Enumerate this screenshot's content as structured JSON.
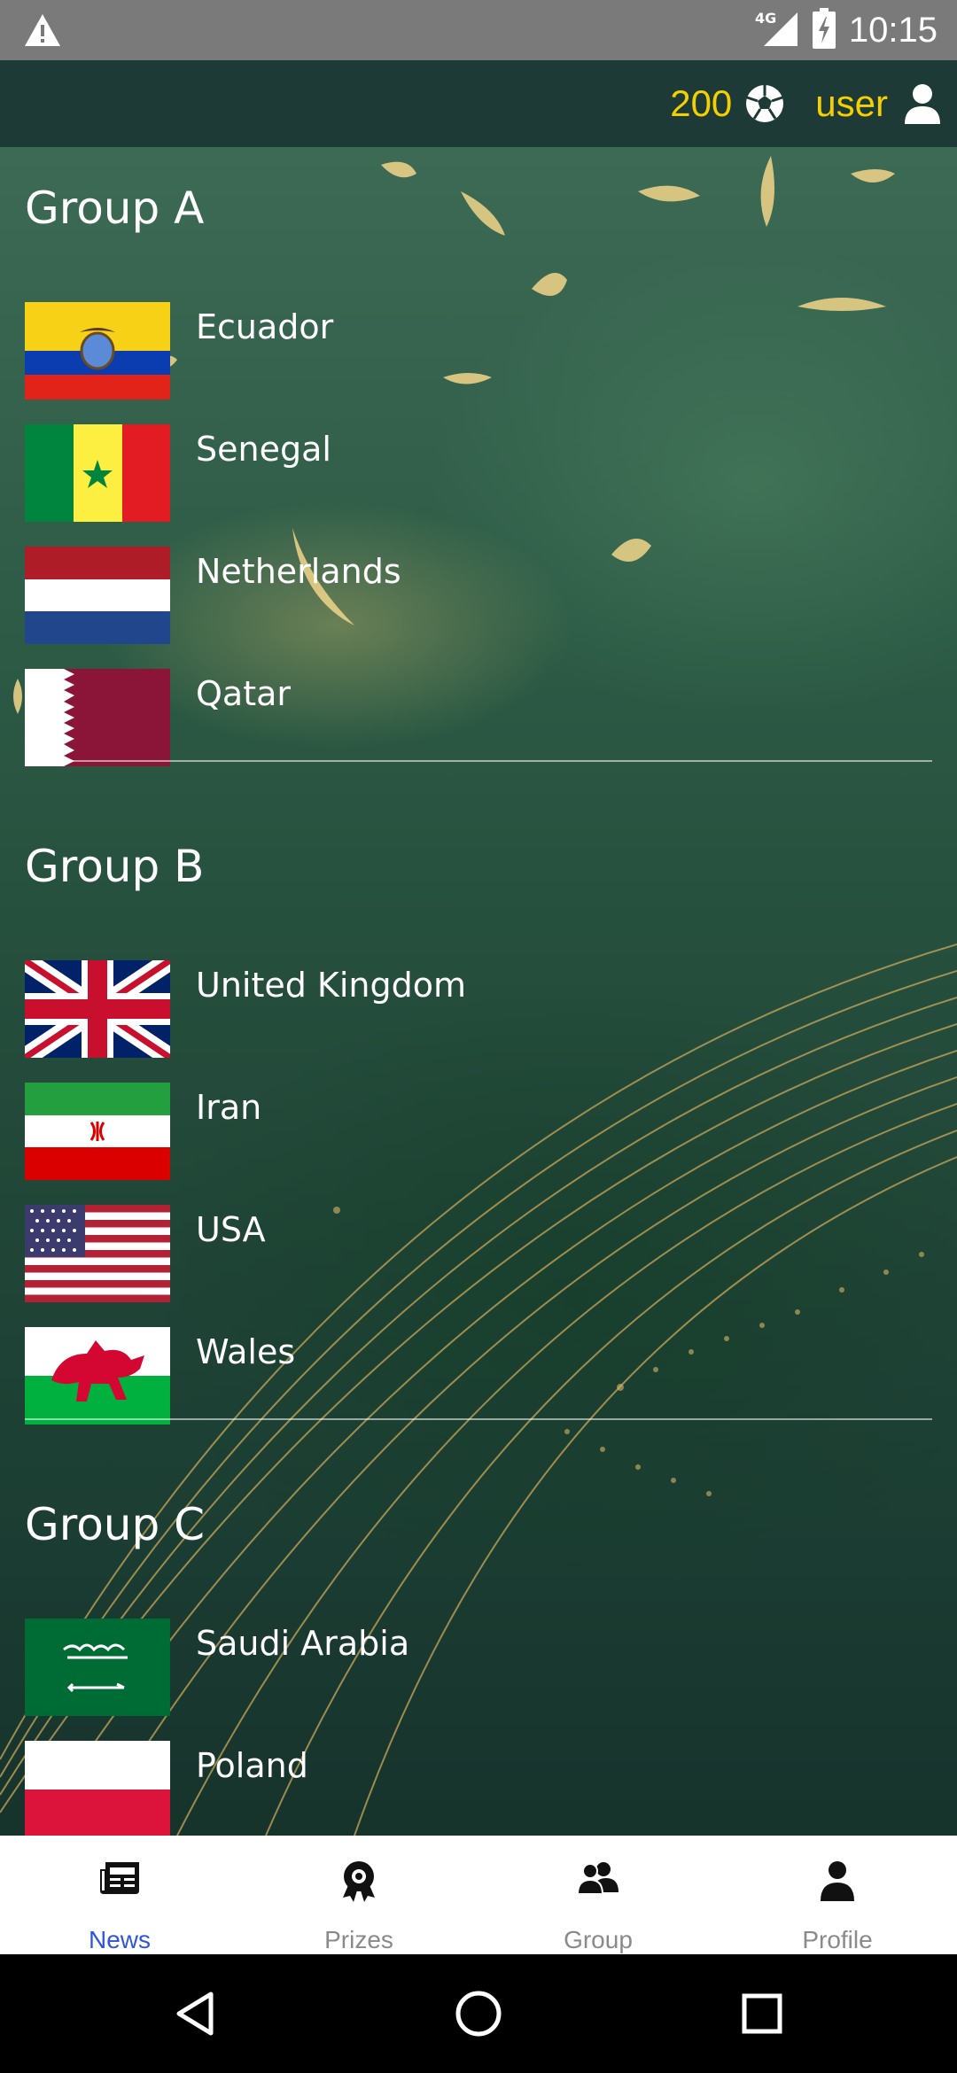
{
  "status_bar": {
    "time": "10:15",
    "network": "4G",
    "icons": [
      "warning-icon",
      "signal-icon",
      "battery-charging-icon"
    ]
  },
  "app_bar": {
    "coins": "200",
    "coin_icon": "soccer-ball-icon",
    "username": "user",
    "user_icon": "person-icon",
    "accent_color": "#f5d000",
    "background_color": "#1d3a36"
  },
  "groups": [
    {
      "title": "Group A",
      "teams": [
        {
          "name": "Ecuador",
          "flag": "ecuador-flag"
        },
        {
          "name": "Senegal",
          "flag": "senegal-flag"
        },
        {
          "name": "Netherlands",
          "flag": "netherlands-flag"
        },
        {
          "name": "Qatar",
          "flag": "qatar-flag"
        }
      ]
    },
    {
      "title": "Group B",
      "teams": [
        {
          "name": "United Kingdom",
          "flag": "united-kingdom-flag"
        },
        {
          "name": "Iran",
          "flag": "iran-flag"
        },
        {
          "name": "USA",
          "flag": "usa-flag"
        },
        {
          "name": "Wales",
          "flag": "wales-flag"
        }
      ]
    },
    {
      "title": "Group C",
      "teams": [
        {
          "name": "Saudi Arabia",
          "flag": "saudi-arabia-flag"
        },
        {
          "name": "Poland",
          "flag": "poland-flag"
        }
      ]
    }
  ],
  "bottom_nav": {
    "items": [
      {
        "label": "News",
        "icon": "newspaper-icon",
        "active": true
      },
      {
        "label": "Prizes",
        "icon": "award-icon",
        "active": false
      },
      {
        "label": "Group",
        "icon": "people-icon",
        "active": false
      },
      {
        "label": "Profile",
        "icon": "person-icon",
        "active": false
      }
    ],
    "active_color": "#2f55e0",
    "inactive_color": "#8a8a8a"
  },
  "system_nav": [
    "back-icon",
    "home-icon",
    "recents-icon"
  ]
}
